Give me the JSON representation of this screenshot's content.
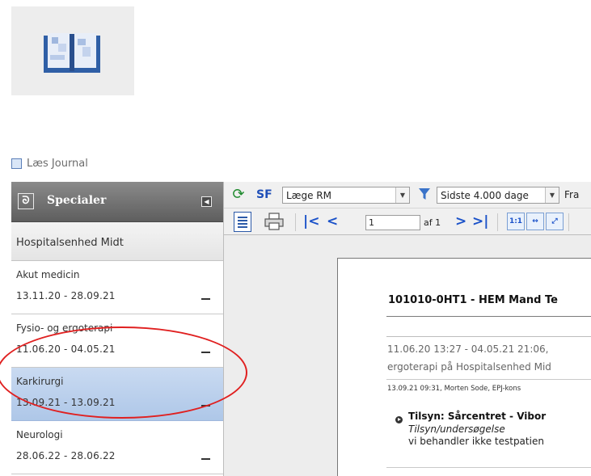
{
  "window": {
    "title": "Læs Journal"
  },
  "specialer": {
    "title": "Specialer",
    "hospital": "Hospitalsenhed Midt",
    "items": [
      {
        "name": "Akut medicin",
        "dates": "13.11.20 - 28.09.21"
      },
      {
        "name": "Fysio- og ergoterapi",
        "dates": "11.06.20 - 04.05.21"
      },
      {
        "name": "Karkirurgi",
        "dates": "13.09.21 - 13.09.21",
        "selected": true
      },
      {
        "name": "Neurologi",
        "dates": "28.06.22 - 28.06.22"
      }
    ]
  },
  "toolbar1": {
    "sf_label": "SF",
    "doctor_select": "Læge RM",
    "period_select": "Sidste 4.000 dage",
    "fra_label": "Fra"
  },
  "toolbar2": {
    "page_value": "1",
    "page_of": "af 1",
    "zoom_actual": "1:1"
  },
  "document": {
    "title": "101010-0HT1 - HEM Mand Te",
    "line1": "11.06.20 13:27 - 04.05.21 21:06,",
    "line2": "ergoterapi på Hospitalsenhed Mid",
    "meta": "13.09.21 09:31, Morten Sode, EPJ-kons",
    "note_heading": "Tilsyn: Sårcentret - Vibor",
    "note_sub": "Tilsyn/undersøgelse",
    "note_body": "vi behandler ikke testpatien"
  },
  "colors": {
    "accent_blue": "#1b52c9",
    "selection_blue": "#b7cfec",
    "highlight_ring": "#e02020",
    "header_gray": "#6f6f6f"
  }
}
